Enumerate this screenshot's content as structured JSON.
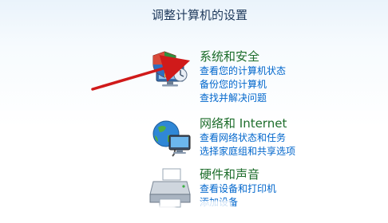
{
  "page": {
    "title": "调整计算机的设置"
  },
  "categories": [
    {
      "title": "系统和安全",
      "links": [
        "查看您的计算机状态",
        "备份您的计算机",
        "查找并解决问题"
      ]
    },
    {
      "title": "网络和 Internet",
      "links": [
        "查看网络状态和任务",
        "选择家庭组和共享选项"
      ]
    },
    {
      "title": "硬件和声音",
      "links": [
        "查看设备和打印机",
        "添加设备"
      ]
    }
  ],
  "icons": {
    "security": "shield-computer-icon",
    "network": "globe-network-icon",
    "hardware": "printer-icon"
  },
  "colors": {
    "category_title": "#1d6d2b",
    "link": "#0066cc",
    "arrow": "#d01a1a"
  }
}
